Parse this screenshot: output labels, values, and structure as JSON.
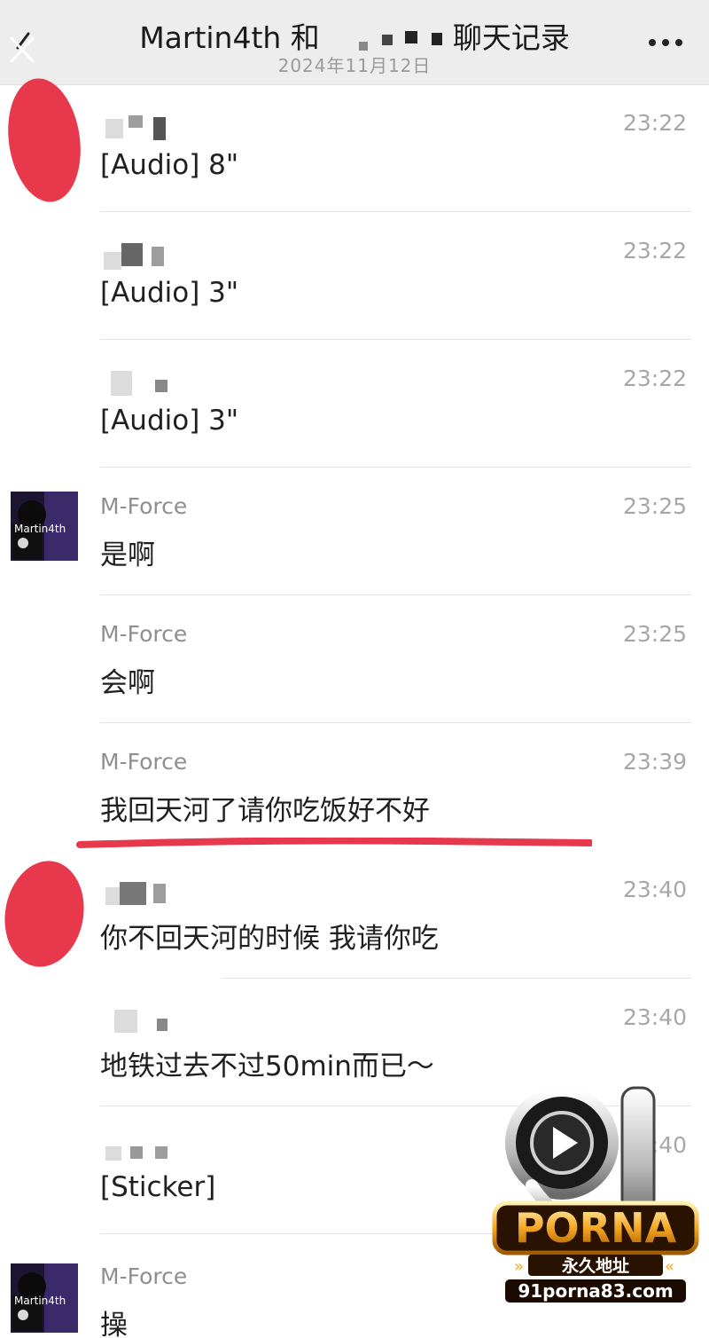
{
  "header": {
    "title_left": "Martin4th 和",
    "title_right": "聊天记录",
    "date": "2024年11月12日",
    "back_icon": "back-arrow-icon",
    "more_icon": "more-dots-icon"
  },
  "messages": [
    {
      "sender": "",
      "time": "23:22",
      "content": "[Audio]  8\""
    },
    {
      "sender": "",
      "time": "23:22",
      "content": "[Audio]  3\""
    },
    {
      "sender": "",
      "time": "23:22",
      "content": "[Audio]  3\""
    },
    {
      "sender": "M-Force",
      "time": "23:25",
      "content": "是啊",
      "avatar_text": "Martin4th"
    },
    {
      "sender": "M-Force",
      "time": "23:25",
      "content": "会啊"
    },
    {
      "sender": "M-Force",
      "time": "23:39",
      "content": "我回天河了请你吃饭好不好"
    },
    {
      "sender": "",
      "time": "23:40",
      "content": "你不回天河的时候 我请你吃"
    },
    {
      "sender": "",
      "time": "23:40",
      "content": "地铁过去不过50min而已～"
    },
    {
      "sender": "",
      "time": "23:40",
      "content": "[Sticker]"
    },
    {
      "sender": "M-Force",
      "time": "",
      "content": "操",
      "avatar_text": "Martin4th"
    }
  ],
  "watermark": {
    "number": "91",
    "brand": "PORNA",
    "tagline": "永久地址",
    "url": "91porna83.com"
  },
  "colors": {
    "header_bg": "#ededed",
    "red_mark": "#e8384b",
    "time_gray": "#a7a7a7",
    "logo_gold": "#f5a623"
  }
}
